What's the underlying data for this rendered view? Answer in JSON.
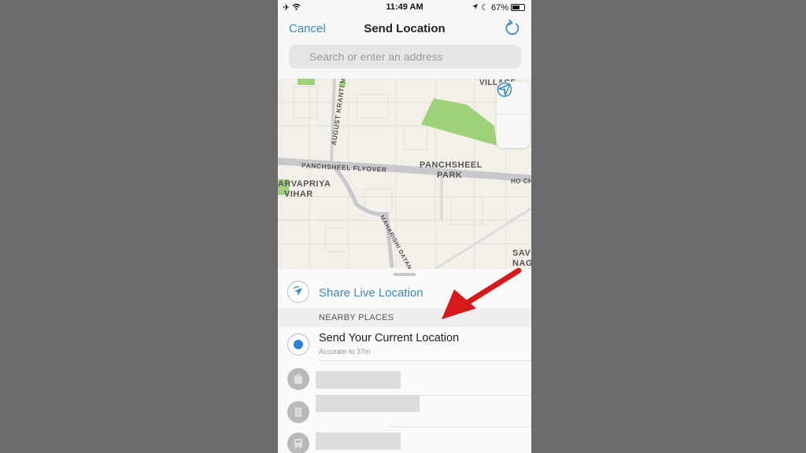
{
  "status_bar": {
    "time": "11:49 AM",
    "battery": "67%",
    "battery_level": 0.67,
    "left_icons": [
      "airplane-icon",
      "wifi-icon"
    ],
    "right_icons": [
      "location-arrow-icon",
      "moon-icon",
      "battery-icon"
    ]
  },
  "nav": {
    "cancel_label": "Cancel",
    "title": "Send Location",
    "refresh_icon": "refresh-icon"
  },
  "search": {
    "placeholder": "Search or enter an address",
    "value": ""
  },
  "map": {
    "labels": {
      "village": "VILLAGE",
      "august_kranti": "AUGUST KRANTI M",
      "panchsheel_flyover": "PANCHSHEEL FLYOVER",
      "panchsheel_park_1": "PANCHSHEEL",
      "panchsheel_park_2": "PARK",
      "sarvapriya_1": "ARVAPRIYA",
      "sarvapriya_2": "VIHAR",
      "ho_chi": "HO CH",
      "maharishi": "MAHARISHI DAYANAND",
      "savitri_1": "SAVIT",
      "savitri_2": "NAGA"
    },
    "controls": [
      "info-icon",
      "location-arrow-icon"
    ]
  },
  "sheet": {
    "share_live_label": "Share Live Location",
    "nearby_header": "NEARBY PLACES",
    "current_location": {
      "title": "Send Your Current Location",
      "subtitle": "Accurate to 37m"
    },
    "places": [
      {
        "icon": "shopping-bag-icon",
        "name": "[blurred]"
      },
      {
        "icon": "building-icon",
        "name": "[blurred]"
      },
      {
        "icon": "bus-icon",
        "name": "[blurred]"
      }
    ]
  },
  "colors": {
    "accent": "#3b88c3",
    "annotation_arrow": "#d7191c",
    "background": "#6b6b6b"
  }
}
